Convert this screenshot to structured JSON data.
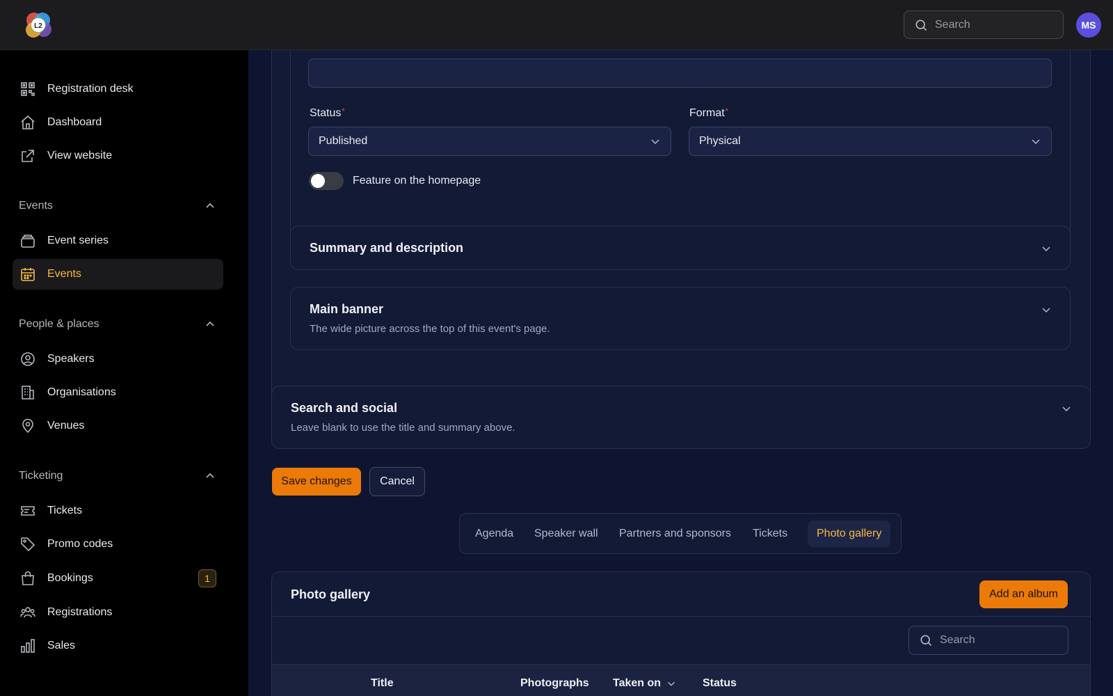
{
  "logo": {
    "text": "L2"
  },
  "header": {
    "search_placeholder": "Search",
    "avatar_initials": "MS"
  },
  "sidebar": {
    "top_items": [
      {
        "label": "Registration desk",
        "icon": "qr-code-icon"
      },
      {
        "label": "Dashboard",
        "icon": "home-icon"
      },
      {
        "label": "View website",
        "icon": "external-link-icon"
      }
    ],
    "sections": [
      {
        "title": "Events",
        "items": [
          {
            "label": "Event series",
            "icon": "stack-icon"
          },
          {
            "label": "Events",
            "icon": "calendar-icon",
            "active": true
          }
        ]
      },
      {
        "title": "People & places",
        "items": [
          {
            "label": "Speakers",
            "icon": "user-circle-icon"
          },
          {
            "label": "Organisations",
            "icon": "building-icon"
          },
          {
            "label": "Venues",
            "icon": "map-pin-icon"
          }
        ]
      },
      {
        "title": "Ticketing",
        "items": [
          {
            "label": "Tickets",
            "icon": "ticket-icon"
          },
          {
            "label": "Promo codes",
            "icon": "tag-icon"
          },
          {
            "label": "Bookings",
            "icon": "shopping-bag-icon",
            "badge": "1"
          },
          {
            "label": "Registrations",
            "icon": "users-icon"
          },
          {
            "label": "Sales",
            "icon": "bar-chart-icon"
          }
        ]
      }
    ]
  },
  "form": {
    "status": {
      "label": "Status",
      "value": "Published"
    },
    "format": {
      "label": "Format",
      "value": "Physical"
    },
    "feature_toggle": {
      "label": "Feature on the homepage",
      "on": false
    },
    "summary_section": {
      "title": "Summary and description"
    },
    "banner_section": {
      "title": "Main banner",
      "subtitle": "The wide picture across the top of this event's page."
    },
    "seo_section": {
      "title": "Search and social",
      "subtitle": "Leave blank to use the title and summary above."
    },
    "save_label": "Save changes",
    "cancel_label": "Cancel"
  },
  "tabs": [
    {
      "label": "Agenda"
    },
    {
      "label": "Speaker wall"
    },
    {
      "label": "Partners and sponsors"
    },
    {
      "label": "Tickets"
    },
    {
      "label": "Photo gallery",
      "active": true
    }
  ],
  "gallery": {
    "title": "Photo gallery",
    "add_label": "Add an album",
    "search_placeholder": "Search",
    "columns": [
      "Title",
      "Photographs",
      "Taken on",
      "Status"
    ]
  },
  "colors": {
    "accent": "#ec7a08",
    "active_text": "#f6b93b",
    "avatar": "#5b4fe0"
  }
}
